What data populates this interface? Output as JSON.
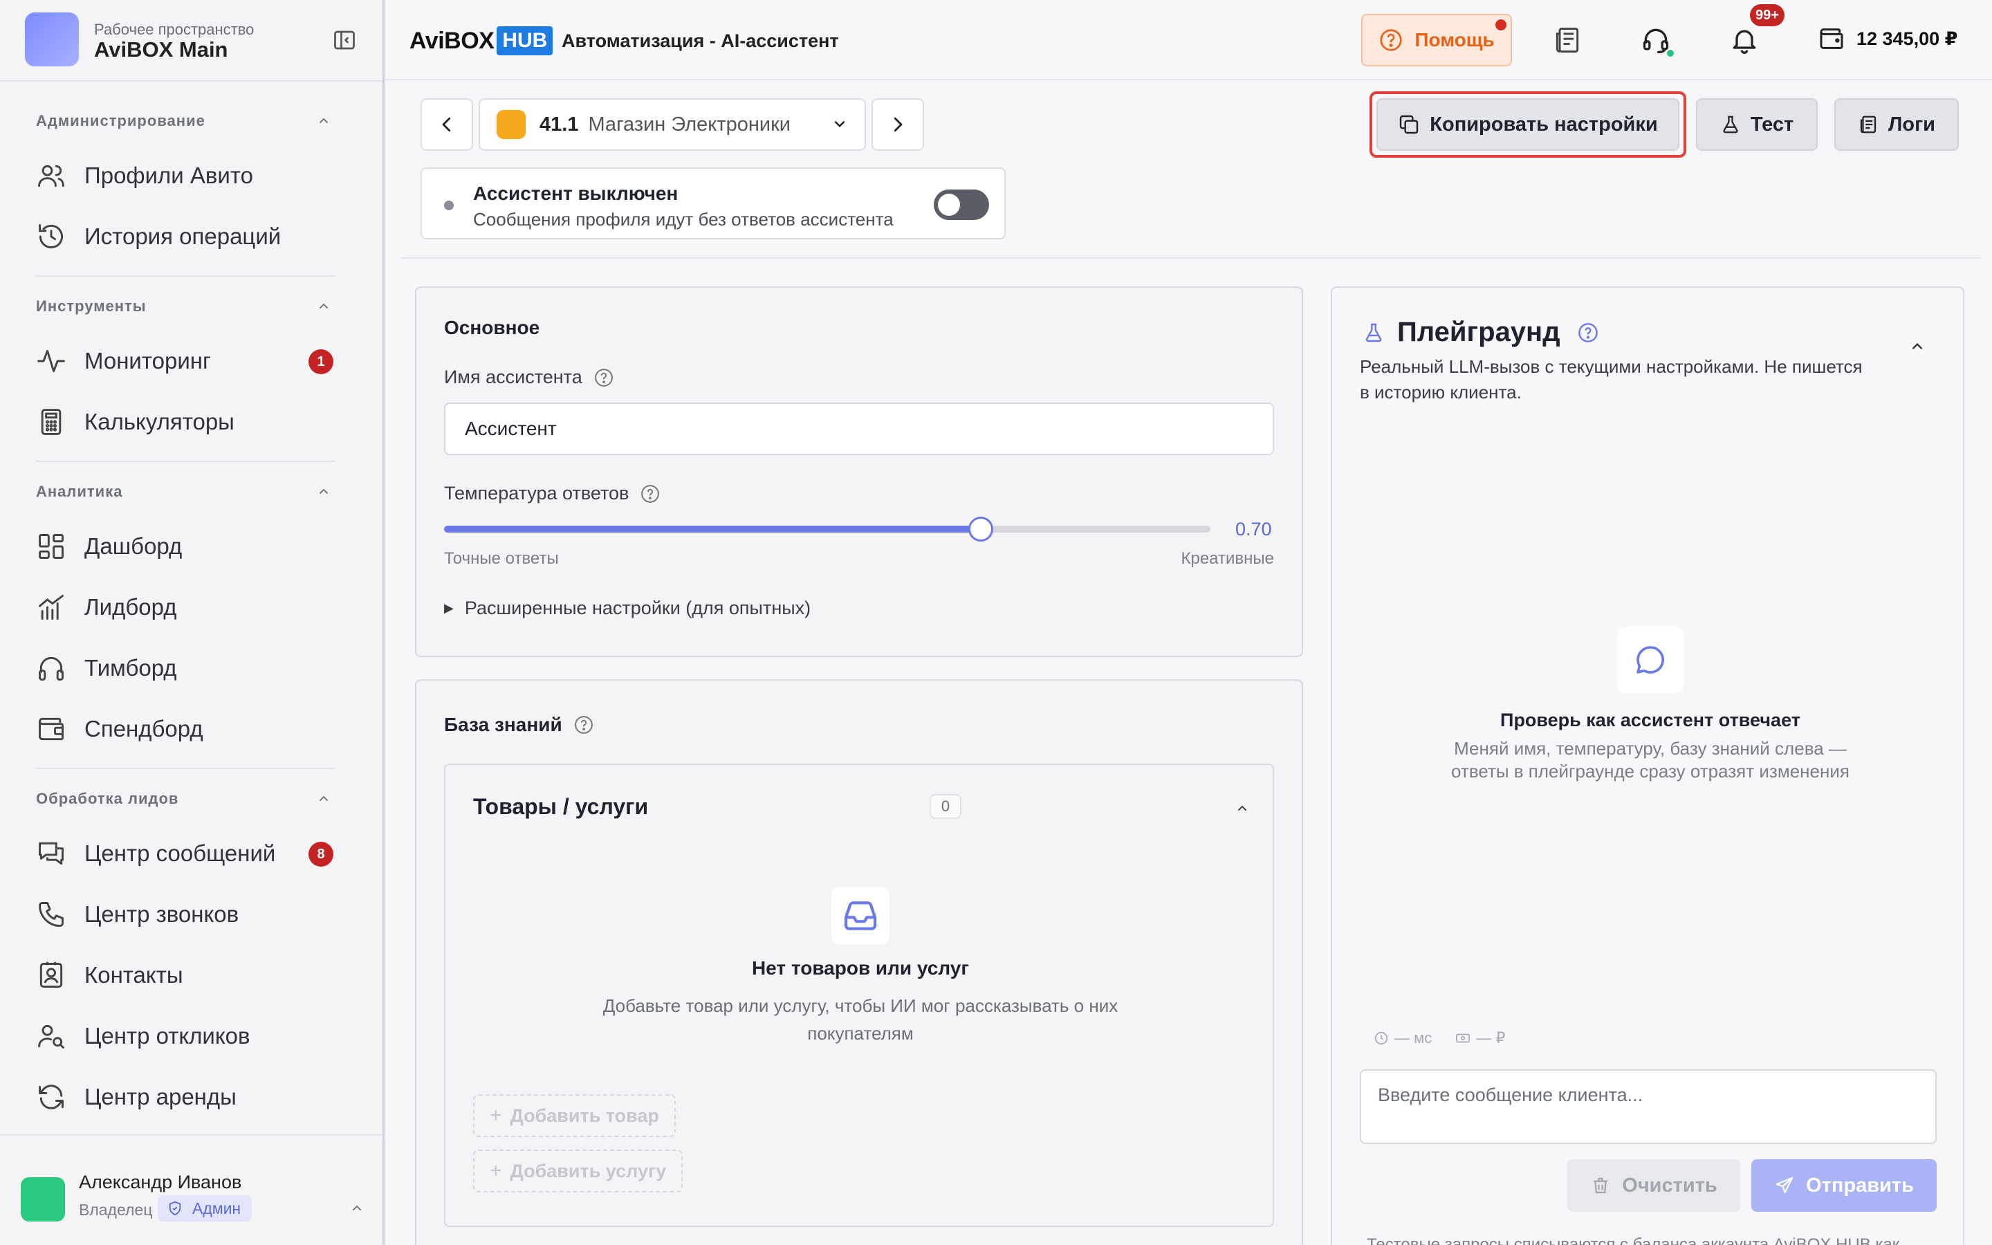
{
  "workspace": {
    "label": "Рабочее пространство",
    "name": "AviBOX Main"
  },
  "sidebar": {
    "sections": [
      {
        "title": "Администрирование",
        "items": [
          {
            "label": "Профили Авито"
          },
          {
            "label": "История операций"
          }
        ]
      },
      {
        "title": "Инструменты",
        "items": [
          {
            "label": "Мониторинг",
            "badge": "1"
          },
          {
            "label": "Калькуляторы"
          }
        ]
      },
      {
        "title": "Аналитика",
        "items": [
          {
            "label": "Дашборд"
          },
          {
            "label": "Лидборд"
          },
          {
            "label": "Тимборд"
          },
          {
            "label": "Спендборд"
          }
        ]
      },
      {
        "title": "Обработка лидов",
        "items": [
          {
            "label": "Центр сообщений",
            "badge": "8"
          },
          {
            "label": "Центр звонков"
          },
          {
            "label": "Контакты"
          },
          {
            "label": "Центр откликов"
          },
          {
            "label": "Центр аренды"
          }
        ]
      }
    ]
  },
  "user": {
    "name": "Александр Иванов",
    "role": "Владелец",
    "badge": "Админ"
  },
  "header": {
    "logo_text": "AviBOX",
    "logo_hub": "HUB",
    "title": "Автоматизация - AI-ассистент",
    "help_label": "Помощь",
    "notifications_badge": "99+",
    "balance": "12 345,00 ₽"
  },
  "toolbar": {
    "profile_number": "41.1",
    "profile_name": "Магазин Электроники",
    "copy_label": "Копировать настройки",
    "test_label": "Тест",
    "logs_label": "Логи"
  },
  "assistant_status": {
    "title": "Ассистент выключен",
    "subtitle": "Сообщения профиля идут без ответов ассистента",
    "enabled": false
  },
  "basic": {
    "title": "Основное",
    "name_label": "Имя ассистента",
    "name_value": "Ассистент",
    "temperature_label": "Температура ответов",
    "temperature_value": "0.70",
    "temperature_fraction": 0.7,
    "temperature_min_label": "Точные ответы",
    "temperature_max_label": "Креативные",
    "advanced_label": "Расширенные настройки (для опытных)"
  },
  "knowledge": {
    "title": "База знаний",
    "products": {
      "title": "Товары / услуги",
      "count": "0",
      "empty_title": "Нет товаров или услуг",
      "empty_sub": "Добавьте товар или услугу, чтобы ИИ мог рассказывать о них покупателям",
      "add_product": "Добавить товар",
      "add_service": "Добавить услугу"
    }
  },
  "playground": {
    "title": "Плейграунд",
    "description": "Реальный LLM-вызов с текущими настройками. Не пишется в историю клиента.",
    "empty_title": "Проверь как ассистент отвечает",
    "empty_sub": "Меняй имя, температуру, базу знаний слева — ответы в плейграунде сразу отразят изменения",
    "latency": "— мс",
    "cost": "— ₽",
    "input_placeholder": "Введите сообщение клиента...",
    "clear_label": "Очистить",
    "send_label": "Отправить",
    "footer": "Тестовые запросы списываются с баланса аккаунта AviBOX HUB как"
  },
  "colors": {
    "accent": "#6b79e8",
    "badge": "#c42424",
    "help": "#e8621c",
    "highlight": "#e2403a"
  }
}
